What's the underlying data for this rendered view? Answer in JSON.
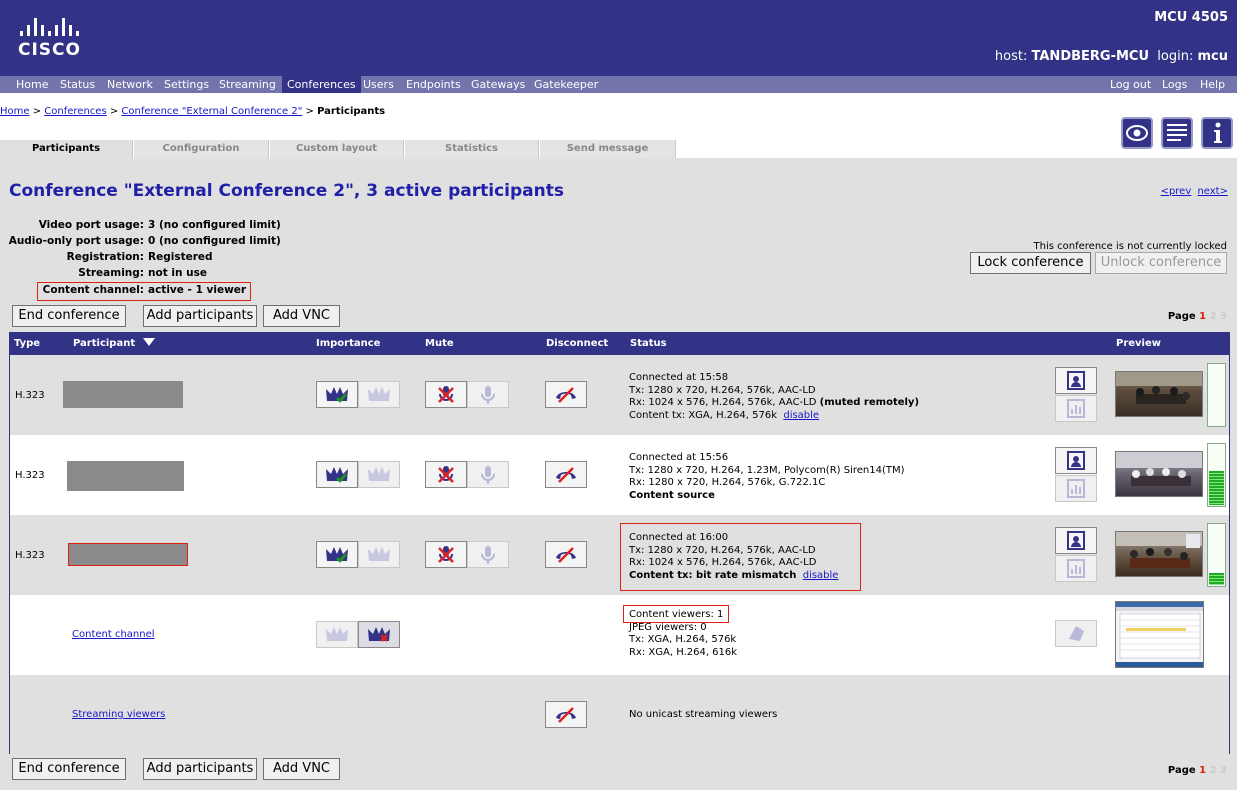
{
  "header": {
    "logo_text": "cisco",
    "product": "MCU 4505",
    "host_label": "host:",
    "host_value": "TANDBERG-MCU",
    "login_label": "login:",
    "login_value": "mcu"
  },
  "nav": {
    "items": [
      "Home",
      "Status",
      "Network",
      "Settings",
      "Streaming",
      "Conferences",
      "Users",
      "Endpoints",
      "Gateways",
      "Gatekeeper"
    ],
    "active": "Conferences",
    "right": [
      "Log out",
      "Logs",
      "Help"
    ]
  },
  "breadcrumb": {
    "home": "Home",
    "conferences": "Conferences",
    "conference": "Conference \"External Conference 2\"",
    "current": "Participants",
    "sep": ">"
  },
  "tabs": [
    "Participants",
    "Configuration",
    "Custom layout",
    "Statistics",
    "Send message"
  ],
  "icons": [
    "eye-icon",
    "text-help-icon",
    "info-icon"
  ],
  "page": {
    "title": "Conference \"External Conference 2\", 3 active participants",
    "prev": "<prev",
    "next": "next>"
  },
  "info": [
    {
      "label": "Video port usage:",
      "value": "3 (no configured limit)"
    },
    {
      "label": "Audio-only port usage:",
      "value": "0 (no configured limit)"
    },
    {
      "label": "Registration:",
      "value": "Registered"
    },
    {
      "label": "Streaming:",
      "value": "not in use"
    },
    {
      "label": "Content channel:",
      "value": "active - 1 viewer"
    }
  ],
  "lock": {
    "message": "This conference is not currently locked",
    "lock_button": "Lock conference",
    "unlock_button": "Unlock conference"
  },
  "actions": {
    "end": "End conference",
    "add": "Add participants",
    "vnc": "Add VNC"
  },
  "pagination": {
    "label": "Page",
    "current": "1",
    "others": [
      "2",
      "3"
    ]
  },
  "table": {
    "headers": {
      "type": "Type",
      "participant": "Participant",
      "importance": "Importance",
      "mute": "Mute",
      "disconnect": "Disconnect",
      "status": "Status",
      "preview": "Preview"
    },
    "rows": [
      {
        "type": "H.323",
        "status": [
          "Connected at 15:58",
          "Tx: 1280 x 720, H.264, 576k, AAC-LD",
          "Rx: 1024 x 576, H.264, 576k, AAC-LD"
        ],
        "status_bold_suffix": "(muted remotely)",
        "content_line": "Content tx: XGA, H.264, 576k",
        "link": "disable",
        "audio_level": 0.0
      },
      {
        "type": "H.323",
        "status": [
          "Connected at 15:56",
          "Tx: 1280 x 720, H.264, 1.23M, Polycom(R) Siren14(TM)",
          "Rx: 1280 x 720, H.264, 576k, G.722.1C"
        ],
        "content_line": "Content source",
        "audio_level": 0.55
      },
      {
        "type": "H.323",
        "status": [
          "Connected at 16:00",
          "Tx: 1280 x 720, H.264, 576k, AAC-LD",
          "Rx: 1024 x 576, H.264, 576k, AAC-LD"
        ],
        "content_line": "Content tx: bit rate mismatch",
        "link": "disable",
        "audio_level": 0.2
      }
    ],
    "content_channel": {
      "label": "Content channel",
      "status": [
        "Content viewers: 1",
        "JPEG viewers: 0",
        "Tx: XGA, H.264, 576k",
        "Rx: XGA, H.264, 616k"
      ]
    },
    "streaming": {
      "label": "Streaming viewers",
      "status": "No unicast streaming viewers"
    }
  },
  "colors": {
    "header": "#323386",
    "nav": "#7374ac",
    "title": "#1f1fa8",
    "highlight": "#dd2211"
  }
}
